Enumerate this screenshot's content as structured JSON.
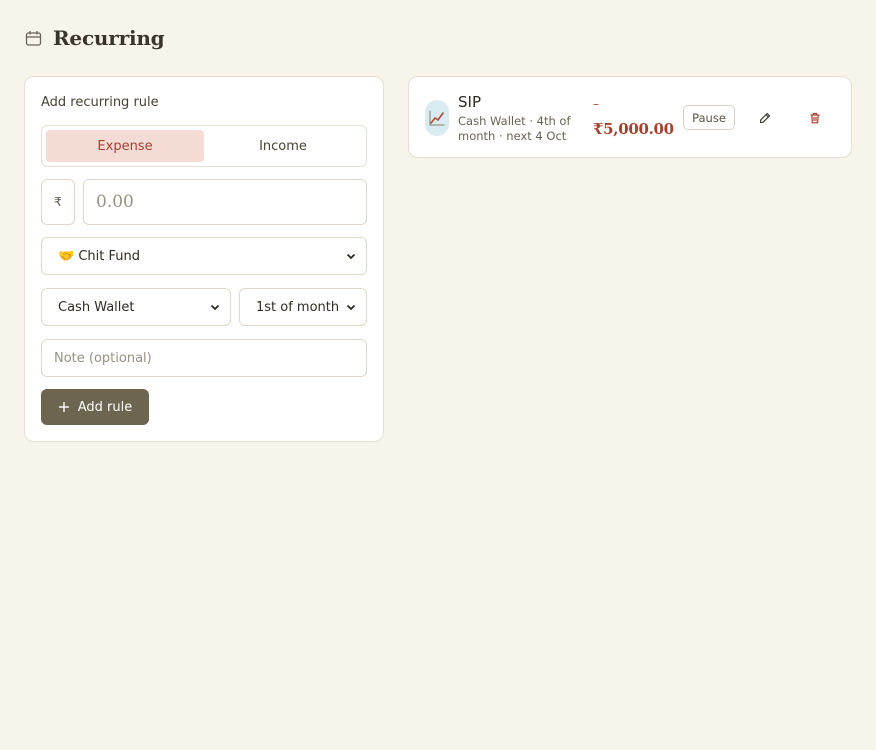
{
  "header": {
    "title": "Recurring",
    "icon": "calendar-icon"
  },
  "form": {
    "heading": "Add recurring rule",
    "type_toggle": {
      "expense_label": "Expense",
      "income_label": "Income",
      "active": "Expense"
    },
    "currency_symbol": "₹",
    "amount": {
      "value": "",
      "placeholder": "0.00"
    },
    "category": {
      "selected": "🤝 Chit Fund"
    },
    "wallet": {
      "selected": "Cash Wallet"
    },
    "day": {
      "selected": "1st of month"
    },
    "note": {
      "value": "",
      "placeholder": "Note (optional)"
    },
    "add_button_label": "Add rule"
  },
  "rules": [
    {
      "name": "SIP",
      "meta": "Cash Wallet · 4th of month · next 4 Oct",
      "sign": "–",
      "amount": "₹5,000.00",
      "icon": "chart-up-icon",
      "pause_label": "Pause"
    }
  ],
  "colors": {
    "background": "#f7f4ec",
    "accent_expense": "#a4402c",
    "expense_tint": "#f4dcd5",
    "button_bg": "#6c6650",
    "card_border": "#e6dfd1"
  }
}
